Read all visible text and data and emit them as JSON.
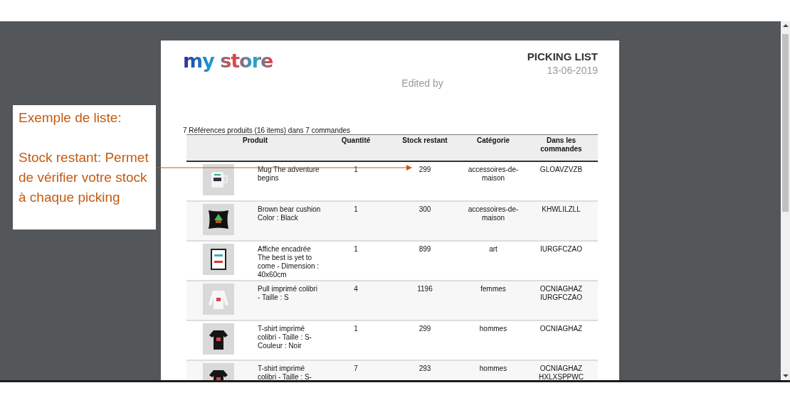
{
  "callout": {
    "title": "Exemple de liste:",
    "text": "Stock restant: Permet de vérifier votre stock à chaque picking"
  },
  "document": {
    "logo": "my store",
    "title": "PICKING LIST",
    "date": "13-06-2019",
    "edited_by": "Edited by",
    "summary": "7 Références produits (16 items) dans 7 commandes",
    "table": {
      "columns": [
        "Produit",
        "Quantité",
        "Stock restant",
        "Catégorie",
        "Dans les commandes"
      ],
      "rows": [
        {
          "image": {
            "kind": "picture"
          },
          "product": "Mug The adventure begins",
          "quantity": "1",
          "stock": "299",
          "category": "accessoires-de-maison",
          "orders": [
            "GLOAVZVZB"
          ]
        },
        {
          "image": {
            "kind": "picture"
          },
          "product": "Brown bear cushion Color : Black",
          "quantity": "1",
          "stock": "300",
          "category": "accessoires-de-maison",
          "orders": [
            "KHWLILZLL"
          ]
        },
        {
          "image": {
            "kind": "picture"
          },
          "product": "Affiche encadrée The best is yet to come - Dimension : 40x60cm",
          "quantity": "1",
          "stock": "899",
          "category": "art",
          "orders": [
            "IURGFCZAO"
          ]
        },
        {
          "image": {
            "kind": "picture"
          },
          "product": "Pull imprimé colibri - Taille : S",
          "quantity": "4",
          "stock": "1196",
          "category": "femmes",
          "orders": [
            "OCNIAGHAZ",
            "IURGFCZAO"
          ]
        },
        {
          "image": {
            "kind": "picture"
          },
          "product": "T-shirt imprimé colibri - Taille : S-Couleur : Noir",
          "quantity": "1",
          "stock": "299",
          "category": "hommes",
          "orders": [
            "OCNIAGHAZ"
          ]
        },
        {
          "image": {
            "kind": "picture"
          },
          "product": "T-shirt imprimé colibri - Taille : S-",
          "quantity": "7",
          "stock": "293",
          "category": "hommes",
          "orders": [
            "OCNIAGHAZ",
            "HXLXSPPWC"
          ]
        }
      ]
    }
  }
}
